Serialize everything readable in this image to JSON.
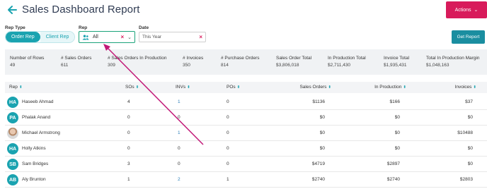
{
  "header": {
    "title": "Sales Dashboard Report",
    "actions_label": "Actions"
  },
  "filters": {
    "rep_type_label": "Rep Type",
    "rep_type_options": [
      "Order Rep",
      "Client Rep"
    ],
    "rep_label": "Rep",
    "rep_value": "All",
    "date_label": "Date",
    "date_value": "This Year",
    "get_report_label": "Get Report"
  },
  "summary": [
    {
      "label": "Number of Rows",
      "value": "49"
    },
    {
      "label": "# Sales Orders",
      "value": "611"
    },
    {
      "label": "# Sales Orders In Production",
      "value": "309"
    },
    {
      "label": "# Invoices",
      "value": "350"
    },
    {
      "label": "# Purchase Orders",
      "value": "814"
    },
    {
      "label": "Sales Order Total",
      "value": "$3,806,018"
    },
    {
      "label": "In Production Total",
      "value": "$2,711,430"
    },
    {
      "label": "Invoice Total",
      "value": "$1,935,431"
    },
    {
      "label": "Total In Production Margin",
      "value": "$1,048,163"
    }
  ],
  "table": {
    "columns": [
      "Rep",
      "SOs",
      "INVs",
      "POs",
      "Sales Orders",
      "In Production",
      "Invoices"
    ],
    "rows": [
      {
        "initials": "HA",
        "name": "Haseeb Ahmad",
        "sos": "4",
        "invs": "1",
        "pos": "0",
        "sales_orders": "$1136",
        "in_production": "$166",
        "invoices": "$37"
      },
      {
        "initials": "PA",
        "name": "Phalak Anand",
        "sos": "0",
        "invs": "0",
        "pos": "0",
        "sales_orders": "$0",
        "in_production": "$0",
        "invoices": "$0"
      },
      {
        "initials": "",
        "name": "Michael Armstrong",
        "sos": "0",
        "invs": "1",
        "pos": "0",
        "sales_orders": "$0",
        "in_production": "$0",
        "invoices": "$10488"
      },
      {
        "initials": "HA",
        "name": "Holly Atkins",
        "sos": "0",
        "invs": "0",
        "pos": "0",
        "sales_orders": "$0",
        "in_production": "$0",
        "invoices": "$0"
      },
      {
        "initials": "SB",
        "name": "Sam Bridges",
        "sos": "3",
        "invs": "0",
        "pos": "0",
        "sales_orders": "$4719",
        "in_production": "$2897",
        "invoices": "$0"
      },
      {
        "initials": "AB",
        "name": "Aly Brunton",
        "sos": "1",
        "invs": "2",
        "pos": "1",
        "sales_orders": "$2740",
        "in_production": "$2740",
        "invoices": "$2803"
      }
    ]
  },
  "colors": {
    "accent": "#1aa3b0",
    "brand": "#d81b5b",
    "link": "#2a7fb8",
    "highlight": "#1aa37a",
    "annotation": "#c21a78"
  },
  "icons": {
    "back": "arrow-left-icon",
    "rep": "people-icon",
    "clear": "close-icon",
    "dropdown": "chevron-down-icon",
    "sort": "sort-icon"
  }
}
